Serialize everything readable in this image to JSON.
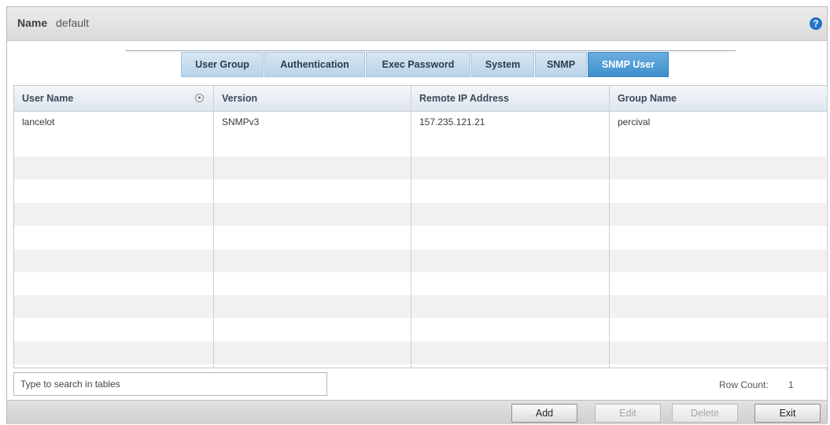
{
  "header": {
    "label": "Name",
    "value": "default",
    "help_icon": "help-icon",
    "help_glyph": "?"
  },
  "tabs": [
    {
      "label": "User Group",
      "active": false
    },
    {
      "label": "Authentication",
      "active": false
    },
    {
      "label": "Exec Password",
      "active": false
    },
    {
      "label": "System",
      "active": false
    },
    {
      "label": "SNMP",
      "active": false
    },
    {
      "label": "SNMP User",
      "active": true
    }
  ],
  "table": {
    "columns": [
      "User Name",
      "Version",
      "Remote IP Address",
      "Group Name"
    ],
    "sort_icon": "sort-indicator-icon",
    "rows": [
      [
        "lancelot",
        "SNMPv3",
        "157.235.121.21",
        "percival"
      ]
    ]
  },
  "search": {
    "placeholder": "Type to search in tables",
    "value": ""
  },
  "row_count": {
    "label": "Row Count:",
    "value": "1"
  },
  "buttons": {
    "add": "Add",
    "edit": "Edit",
    "delete": "Delete",
    "exit": "Exit"
  },
  "colors": {
    "active_tab": "#3f8fcc",
    "tab": "#c7dced",
    "help_icon": "#2275c9"
  }
}
